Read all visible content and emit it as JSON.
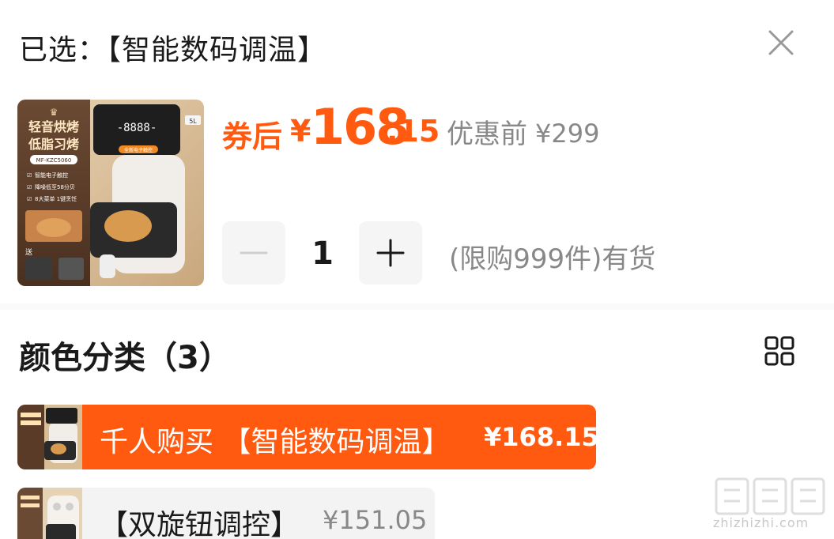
{
  "header": {
    "selected_prefix": "已选：",
    "selected_value": "【智能数码调温】",
    "close_icon": "close-icon"
  },
  "product": {
    "image_texts": {
      "headline_1": "轻音烘烤",
      "headline_2": "低脂习烤",
      "model": "MF-KZC5060",
      "feature_1": "智能电子触控",
      "feature_2": "降噪低至58分贝",
      "feature_3": "8大菜单 1键烹饪",
      "capacity": "5L",
      "panel": "全新电子触控",
      "gift": "送"
    },
    "price_after_coupon_label": "券后",
    "currency": "¥",
    "price_integer": "168",
    "price_decimal": ".15",
    "original_price_label": "优惠前",
    "original_price": "¥299"
  },
  "quantity": {
    "minus_icon": "minus-icon",
    "value": "1",
    "plus_icon": "plus-icon",
    "stock_text": "(限购999件)有货"
  },
  "color_section": {
    "title": "颜色分类（3）",
    "grid_icon": "grid-view-icon",
    "options": [
      {
        "label": "千人购买 【智能数码调温】",
        "price": "¥168.15",
        "selected": true
      },
      {
        "label": "【双旋钮调控】",
        "price": "¥151.05",
        "selected": false
      }
    ]
  },
  "watermark": {
    "text": "zhizhizhi.com"
  },
  "colors": {
    "accent": "#ff5a0f",
    "muted_text": "#888888",
    "button_bg": "#f5f5f5"
  }
}
